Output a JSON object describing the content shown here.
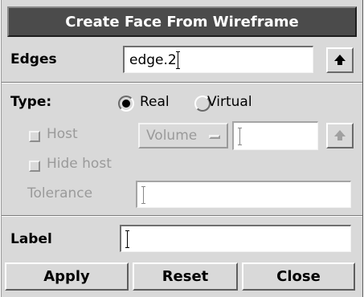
{
  "dialog": {
    "title": "Create Face From Wireframe",
    "edges": {
      "label": "Edges",
      "value": "edge.2"
    },
    "type": {
      "label": "Type:",
      "options": [
        "Real",
        "Virtual"
      ],
      "selected": "Real"
    },
    "host": {
      "label": "Host",
      "checked": false,
      "select_value": "Volume",
      "value": ""
    },
    "hide_host": {
      "label": "Hide host",
      "checked": false
    },
    "tolerance": {
      "label": "Tolerance",
      "value": ""
    },
    "label_field": {
      "label": "Label",
      "value": ""
    },
    "buttons": {
      "apply": "Apply",
      "reset": "Reset",
      "close": "Close"
    }
  },
  "colors": {
    "background": "#d9d9d9",
    "titlebar": "#4b4b4b",
    "disabled_text": "#9a9a9a"
  },
  "icons": {
    "pick": "up-arrow-icon"
  }
}
